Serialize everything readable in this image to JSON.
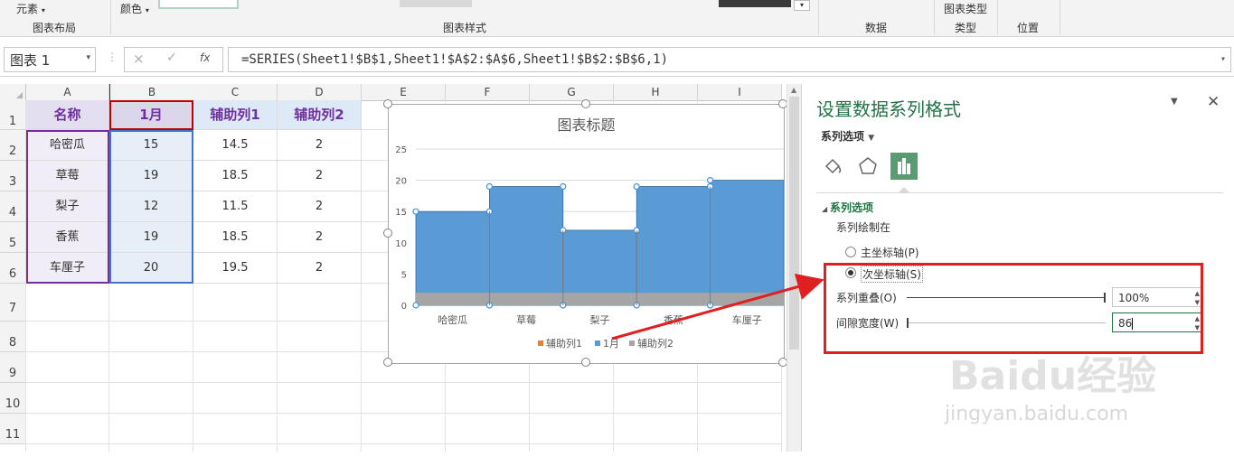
{
  "ribbon": {
    "elements_label": "元素",
    "chart_layout_label": "图表布局",
    "color_label": "颜色",
    "chart_styles_label": "图表样式",
    "data_label": "数据",
    "chart_type_top": "图表类型",
    "type_label": "类型",
    "position_label": "位置"
  },
  "formula_bar": {
    "name_box": "图表 1",
    "cancel_icon": "×",
    "enter_icon": "✓",
    "fx_icon": "fx",
    "formula": "=SERIES(Sheet1!$B$1,Sheet1!$A$2:$A$6,Sheet1!$B$2:$B$6,1)"
  },
  "columns": [
    "A",
    "B",
    "C",
    "D",
    "E",
    "F",
    "G",
    "H",
    "I"
  ],
  "rows": [
    "1",
    "2",
    "3",
    "4",
    "5",
    "6",
    "7",
    "8",
    "9",
    "10",
    "11"
  ],
  "table": {
    "headers": [
      "名称",
      "1月",
      "辅助列1",
      "辅助列2"
    ],
    "rows": [
      [
        "哈密瓜",
        "15",
        "14.5",
        "2"
      ],
      [
        "草莓",
        "19",
        "18.5",
        "2"
      ],
      [
        "梨子",
        "12",
        "11.5",
        "2"
      ],
      [
        "香蕉",
        "19",
        "18.5",
        "2"
      ],
      [
        "车厘子",
        "20",
        "19.5",
        "2"
      ]
    ]
  },
  "chart_data": {
    "type": "bar",
    "title": "图表标题",
    "categories": [
      "哈密瓜",
      "草莓",
      "梨子",
      "香蕉",
      "车厘子"
    ],
    "series": [
      {
        "name": "辅助列1",
        "values": [
          14.5,
          18.5,
          11.5,
          18.5,
          19.5
        ],
        "color": "#ed7d31"
      },
      {
        "name": "1月",
        "values": [
          15,
          19,
          12,
          19,
          20
        ],
        "color": "#5b9bd5"
      },
      {
        "name": "辅助列2",
        "values": [
          2,
          2,
          2,
          2,
          2
        ],
        "color": "#a5a5a5"
      }
    ],
    "ylim": [
      0,
      25
    ],
    "yticks": [
      "0",
      "5",
      "10",
      "15",
      "20",
      "25"
    ],
    "grid": true,
    "legend_position": "bottom",
    "gap_width_percent": 0,
    "overlap_percent": 100
  },
  "pane": {
    "title": "设置数据系列格式",
    "series_options_dropdown": "系列选项",
    "section_title": "系列选项",
    "plot_on_label": "系列绘制在",
    "primary_axis_label": "主坐标轴(P)",
    "secondary_axis_label": "次坐标轴(S)",
    "overlap_label": "系列重叠(O)",
    "overlap_value": "100%",
    "overlap_fraction": 1.0,
    "gap_label": "间隙宽度(W)",
    "gap_value": "86",
    "gap_fraction": 0.0,
    "selected_axis": "secondary"
  },
  "colors": {
    "accent_green": "#217346",
    "highlight_red": "#e02020",
    "header_purple": "#7030a0",
    "series_blue": "#5b9bd5",
    "series_gray": "#a5a5a5"
  },
  "watermark": {
    "text": "Baidu经验",
    "url_text": "jingyan.baidu.com"
  }
}
